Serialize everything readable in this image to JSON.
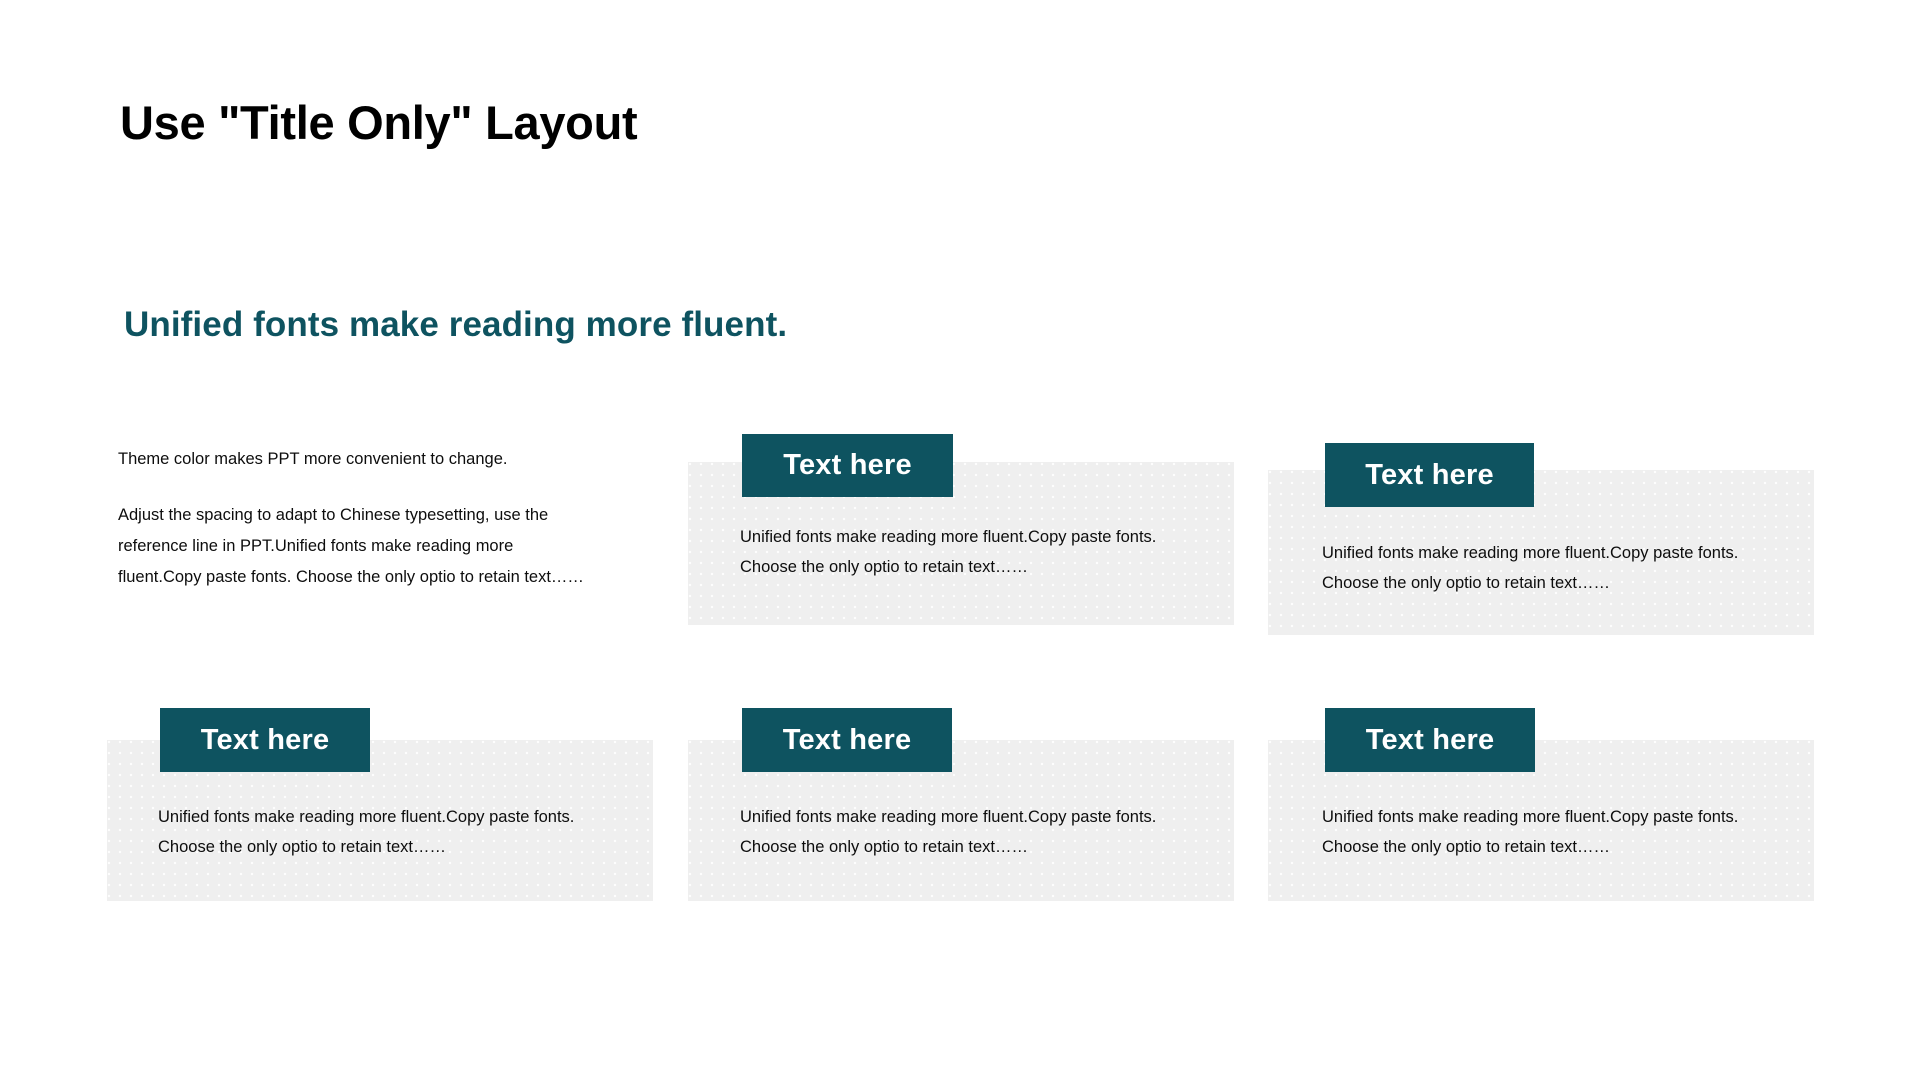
{
  "slide": {
    "title": "Use \"Title Only\" Layout",
    "subtitle": "Unified fonts make reading more fluent.",
    "background_color": "#FFFFFF",
    "accent_color": "#0E5360",
    "panel_color": "#EFEFEF",
    "title_color": "#000000",
    "body_text_color": "#0D0D0D"
  },
  "intro": {
    "lead": "Theme  color makes PPT more convenient to change.",
    "body": "Adjust the spacing to adapt to Chinese typesetting, use the reference line in PPT.Unified fonts make reading more fluent.Copy paste fonts. Choose the only optio to retain text……"
  },
  "cards": [
    {
      "id": "r1c2",
      "badge": "Text here",
      "line1": "Unified fonts make reading more fluent.Copy paste fonts.",
      "line2": "Choose the only optio to retain text……"
    },
    {
      "id": "r1c3",
      "badge": "Text here",
      "line1": "Unified fonts make reading more fluent.Copy paste fonts.",
      "line2": "Choose the only optio to retain text……"
    },
    {
      "id": "r2c1",
      "badge": "Text here",
      "line1": "Unified fonts make reading more fluent.Copy paste fonts.",
      "line2": "Choose the only optio to retain text……"
    },
    {
      "id": "r2c2",
      "badge": "Text here",
      "line1": "Unified fonts make reading more fluent.Copy paste fonts.",
      "line2": "Choose the only optio to retain text……"
    },
    {
      "id": "r2c3",
      "badge": "Text here",
      "line1": "Unified fonts make reading more fluent.Copy paste fonts.",
      "line2": "Choose the only optio to retain text……"
    }
  ]
}
